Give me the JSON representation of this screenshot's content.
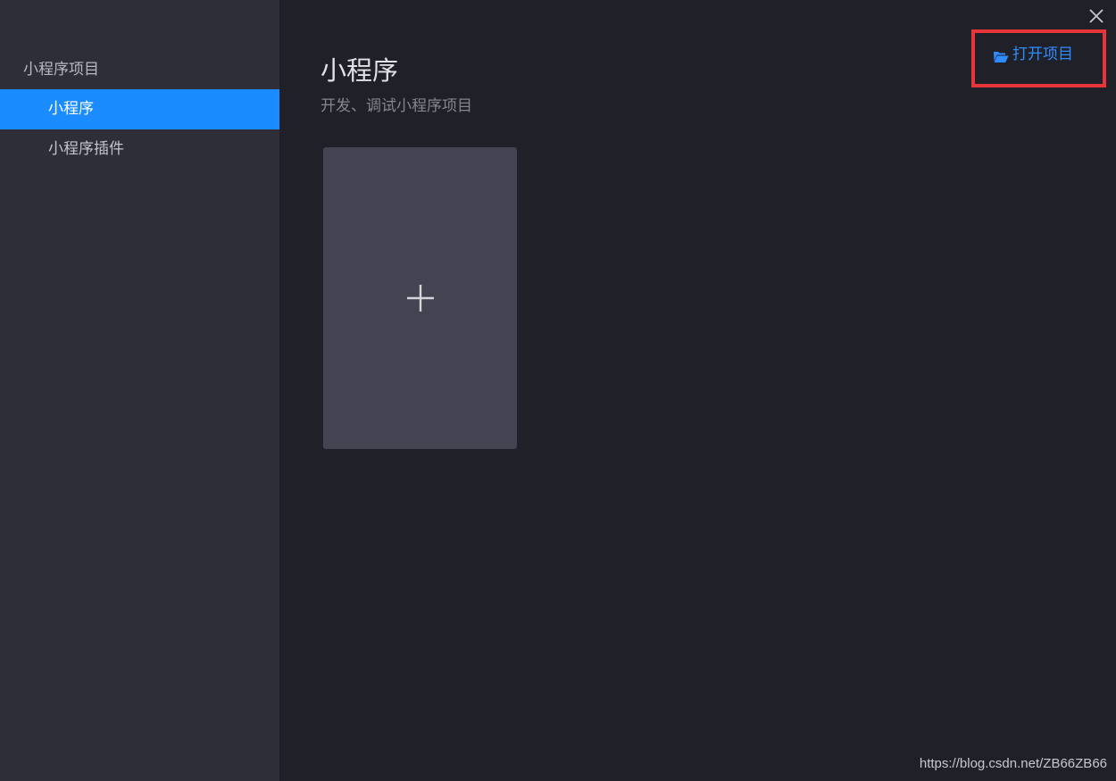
{
  "sidebar": {
    "section_title": "小程序项目",
    "items": [
      {
        "label": "小程序",
        "active": true
      },
      {
        "label": "小程序插件",
        "active": false
      }
    ]
  },
  "main": {
    "title": "小程序",
    "subtitle": "开发、调试小程序项目",
    "new_card_icon": "plus-icon"
  },
  "toolbar": {
    "open_project_label": "打开项目",
    "open_project_icon": "folder-open-icon",
    "close_icon": "close-icon"
  },
  "watermark": "https://blog.csdn.net/ZB66ZB66",
  "colors": {
    "accent": "#1a8cff",
    "link": "#2f8cff",
    "highlight_border": "#e8353a",
    "sidebar_bg": "#2e2e38",
    "main_bg": "#202028",
    "card_bg": "#434352"
  }
}
